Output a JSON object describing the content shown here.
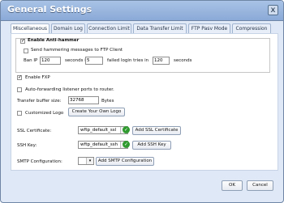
{
  "window": {
    "title": "General Settings",
    "close_label": "x"
  },
  "tabs": [
    {
      "label": "Miscellaneous",
      "active": true
    },
    {
      "label": "Domain Log",
      "active": false
    },
    {
      "label": "Connection Limit",
      "active": false
    },
    {
      "label": "Data Transfer Limit",
      "active": false
    },
    {
      "label": "FTP Pasv Mode",
      "active": false
    },
    {
      "label": "Compression",
      "active": false
    }
  ],
  "anti_hammer": {
    "enable_label": "Enable Anti-hammer",
    "send_messages_label": "Send hammering messages to FTP Client",
    "ban_ip_label": "Ban IP",
    "ban_seconds": "120",
    "seconds_if_label": "seconds if",
    "failed_count": "5",
    "failed_label": "failed login tries in",
    "window_seconds": "120",
    "seconds_label": "seconds"
  },
  "options": {
    "enable_fxp_label": "Enable FXP",
    "auto_forwarding_label": "Auto-forwarding listener ports to router.",
    "transfer_buffer_label": "Transfer buffer size:",
    "transfer_buffer_value": "32768",
    "bytes_label": "Bytes",
    "customized_logo_label": "Customized Logo",
    "create_logo_button": "Create Your Own Logo"
  },
  "ssl": {
    "certificate_label": "SSL Certificate:",
    "certificate_value": "wftp_default_ssl",
    "add_certificate_button": "Add SSL Certificate",
    "key_label": "SSH Key:",
    "key_value": "wftp_default_ssh",
    "add_key_button": "Add SSH Key"
  },
  "smtp": {
    "label": "SMTP Configuration:",
    "value": "",
    "add_button": "Add SMTP Configuration"
  },
  "footer": {
    "ok": "OK",
    "cancel": "Cancel"
  },
  "icons": {
    "check": "check-icon",
    "dropdown": "chevron-down-icon",
    "ok_status": "green-check-icon"
  },
  "colors": {
    "title_bar": "#8aa9d6",
    "window_bg": "#dfe8f6",
    "accent": "#2f9a2f"
  }
}
